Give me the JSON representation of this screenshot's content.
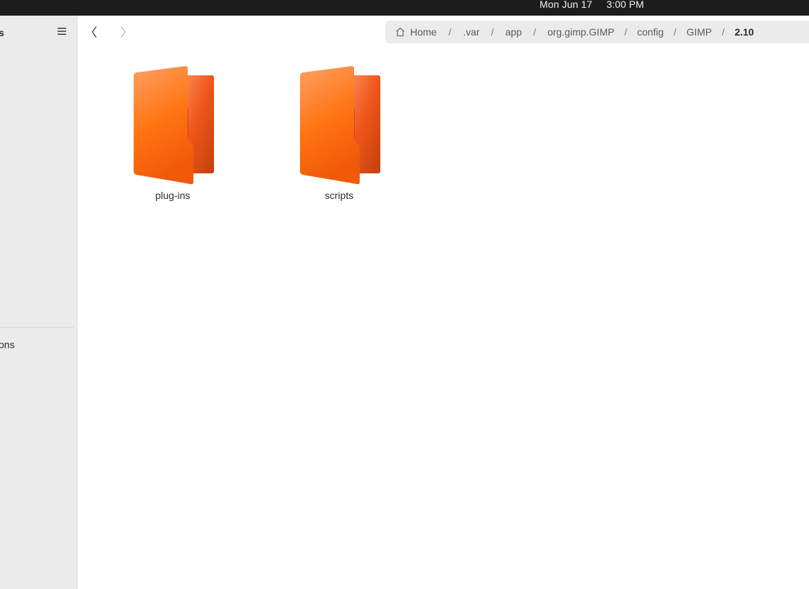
{
  "topbar": {
    "clock": "Mon Jun 17     3:00 PM"
  },
  "sidebar": {
    "title_fragment": "s",
    "item_fragment": "ons"
  },
  "header": {
    "breadcrumbs": [
      {
        "label": "Home",
        "icon": "home-icon"
      },
      {
        "label": ".var"
      },
      {
        "label": "app"
      },
      {
        "label": "org.gimp.GIMP"
      },
      {
        "label": "config"
      },
      {
        "label": "GIMP"
      },
      {
        "label": "2.10",
        "current": true
      }
    ],
    "separator": "/"
  },
  "files": [
    {
      "name": "plug-ins",
      "icon": "folder-icon"
    },
    {
      "name": "scripts",
      "icon": "folder-icon"
    }
  ],
  "colors": {
    "folder_accent": "#ff6a0f",
    "topbar_bg": "#1d1d1d",
    "sidebar_bg": "#ebebeb"
  }
}
